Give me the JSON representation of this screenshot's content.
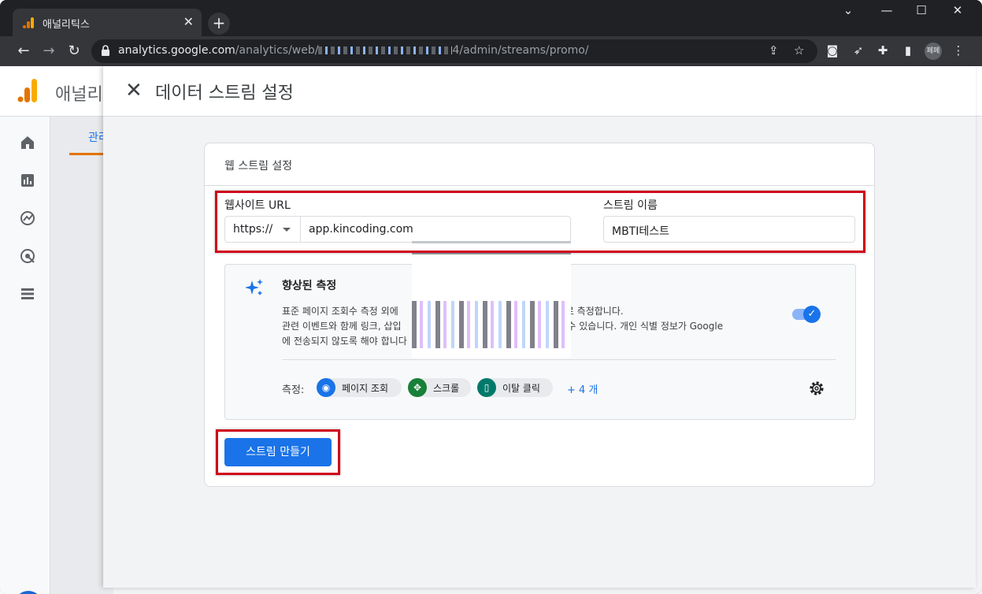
{
  "browser": {
    "tab_title": "애널리틱스",
    "url_host": "analytics.google.com",
    "url_path_prefix": "/analytics/web/",
    "url_path_suffix": "4/admin/streams/promo/",
    "avatar_text": "페페"
  },
  "ga": {
    "app_title": "애널리",
    "bg_tab": "관리"
  },
  "panel": {
    "title": "데이터 스트림 설정",
    "card_title": "웹 스트림 설정",
    "website_url_label": "웹사이트 URL",
    "protocol": "https://",
    "website_url": "app.kincoding.com",
    "stream_name_label": "스트림 이름",
    "stream_name": "MBTI테스트",
    "enhanced": {
      "title": "향상된 측정",
      "desc_1": "표준 페이지 조회수 측정 외에",
      "desc_1_end": "동으로 측정합니다.",
      "desc_2": "관련 이벤트와 함께 링크, 삽입",
      "desc_2_end": "터가 수집될 수 있습니다. 개인 식별 정보가 Google",
      "desc_3": "에 전송되지 않도록 해야 합니다",
      "enabled": true,
      "measure_label": "측정:",
      "chips": [
        {
          "label": "페이지 조회",
          "color": "#1a73e8",
          "icon": "eye-icon"
        },
        {
          "label": "스크롤",
          "color": "#188038",
          "icon": "scroll-icon"
        },
        {
          "label": "이탈 클릭",
          "color": "#00796b",
          "icon": "mouse-icon"
        }
      ],
      "more_label": "+ 4 개"
    },
    "create_button": "스트림 만들기"
  }
}
